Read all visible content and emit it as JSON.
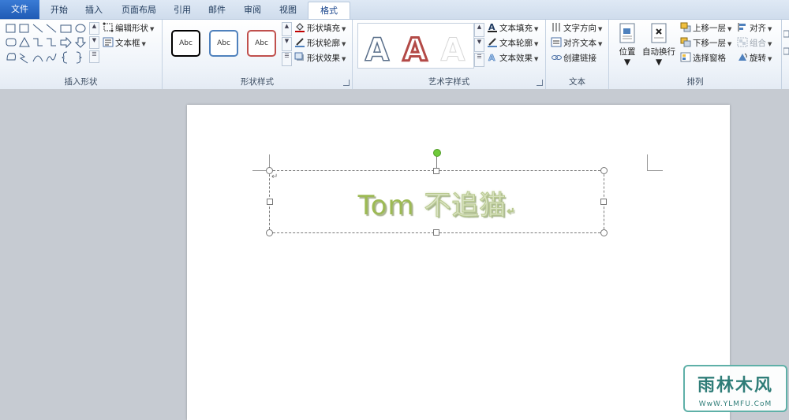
{
  "tabs": [
    "文件",
    "开始",
    "插入",
    "页面布局",
    "引用",
    "邮件",
    "审阅",
    "视图",
    "格式"
  ],
  "active_tab": "格式",
  "groups": {
    "insert_shapes": {
      "label": "插入形状",
      "edit_shape": "编辑形状",
      "text_box": "文本框"
    },
    "shape_styles": {
      "label": "形状样式",
      "style_samples": [
        "Abc",
        "Abc",
        "Abc"
      ],
      "style_colors": [
        "#000000",
        "#4f81bd",
        "#c0504d"
      ],
      "shape_fill": "形状填充",
      "shape_outline": "形状轮廓",
      "shape_effects": "形状效果"
    },
    "wordart_styles": {
      "label": "艺术字样式",
      "samples": [
        "A",
        "A",
        "A"
      ],
      "text_fill": "文本填充",
      "text_outline": "文本轮廓",
      "text_effects": "文本效果"
    },
    "text": {
      "label": "文本",
      "text_direction": "文字方向",
      "align_text": "对齐文本",
      "create_link": "创建链接"
    },
    "arrange": {
      "label": "排列",
      "position": "位置",
      "wrap_text": "自动换行",
      "bring_forward": "上移一层",
      "send_backward": "下移一层",
      "selection_pane": "选择窗格",
      "align": "对齐",
      "group": "组合",
      "rotate": "旋转"
    }
  },
  "document": {
    "wordart_latin": "Tom ",
    "wordart_cjk": "不追猫",
    "paragraph_mark": "↵"
  },
  "watermark": {
    "title": "雨林木风",
    "url": "WwW.YLMFU.CoM"
  },
  "colors": {
    "accent_file_tab": "#2a6bc8",
    "wordart_green": "#9dba54",
    "rotate_handle": "#6fca3a"
  }
}
